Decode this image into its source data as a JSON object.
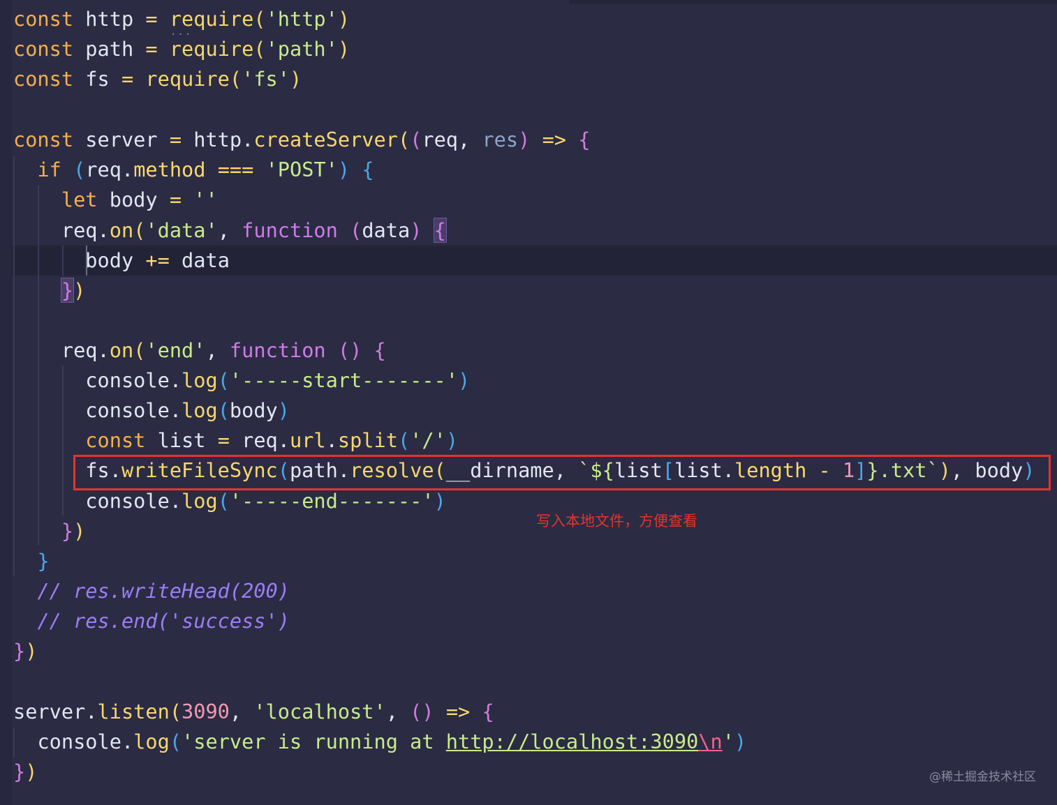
{
  "code": {
    "l1": {
      "kw": "const",
      "name": "http",
      "eq": "=",
      "fn": "require",
      "s": "'http'"
    },
    "l2": {
      "kw": "const",
      "name": "path",
      "eq": "=",
      "fn": "require",
      "s": "'path'"
    },
    "l3": {
      "kw": "const",
      "name": "fs",
      "eq": "=",
      "fn": "require",
      "s": "'fs'"
    },
    "l5": {
      "kw": "const",
      "name": "server",
      "eq": "=",
      "obj": "http",
      "fn": "createServer",
      "p1": "req",
      "p2": "res",
      "arrow": "=>"
    },
    "l6": {
      "kw": "if",
      "obj": "req",
      "prop": "method",
      "op": "===",
      "s": "'POST'"
    },
    "l7": {
      "kw": "let",
      "name": "body",
      "eq": "=",
      "s": "''"
    },
    "l8": {
      "obj": "req",
      "fn": "on",
      "s": "'data'",
      "kw": "function",
      "p": "data"
    },
    "l9": {
      "name": "body",
      "op": "+=",
      "val": "data"
    },
    "l12": {
      "obj": "req",
      "fn": "on",
      "s": "'end'",
      "kw": "function"
    },
    "l13": {
      "obj": "console",
      "fn": "log",
      "s": "'-----start-------'"
    },
    "l14": {
      "obj": "console",
      "fn": "log",
      "val": "body"
    },
    "l15": {
      "kw": "const",
      "name": "list",
      "eq": "=",
      "obj": "req",
      "prop": "url",
      "fn": "split",
      "s": "'/'"
    },
    "l16": {
      "obj": "fs",
      "fn": "writeFileSync",
      "obj2": "path",
      "fn2": "resolve",
      "dirname": "__dirname",
      "tpl_open": "`${",
      "list": "list",
      "list2": "list",
      "length": "length",
      "minus": "-",
      "one": "1",
      "tpl_close": "}.txt`",
      "body": "body"
    },
    "l17": {
      "obj": "console",
      "fn": "log",
      "s": "'-----end-------'"
    },
    "l20": {
      "text": "// res.writeHead(200)"
    },
    "l21": {
      "text": "// res.end('success')"
    },
    "l24": {
      "obj": "server",
      "fn": "listen",
      "num": "3090",
      "s": "'localhost'",
      "arrow": "=>"
    },
    "l25": {
      "obj": "console",
      "fn": "log",
      "s_open": "'server is running at ",
      "url": "http://localhost:3090",
      "esc": "\\n",
      "s_close": "'"
    }
  },
  "annotation": {
    "note": "写入本地文件，方便查看"
  },
  "watermark": "@稀土掘金技术社区",
  "colors": {
    "background": "#2b2b44",
    "highlight": "#e5342d"
  }
}
